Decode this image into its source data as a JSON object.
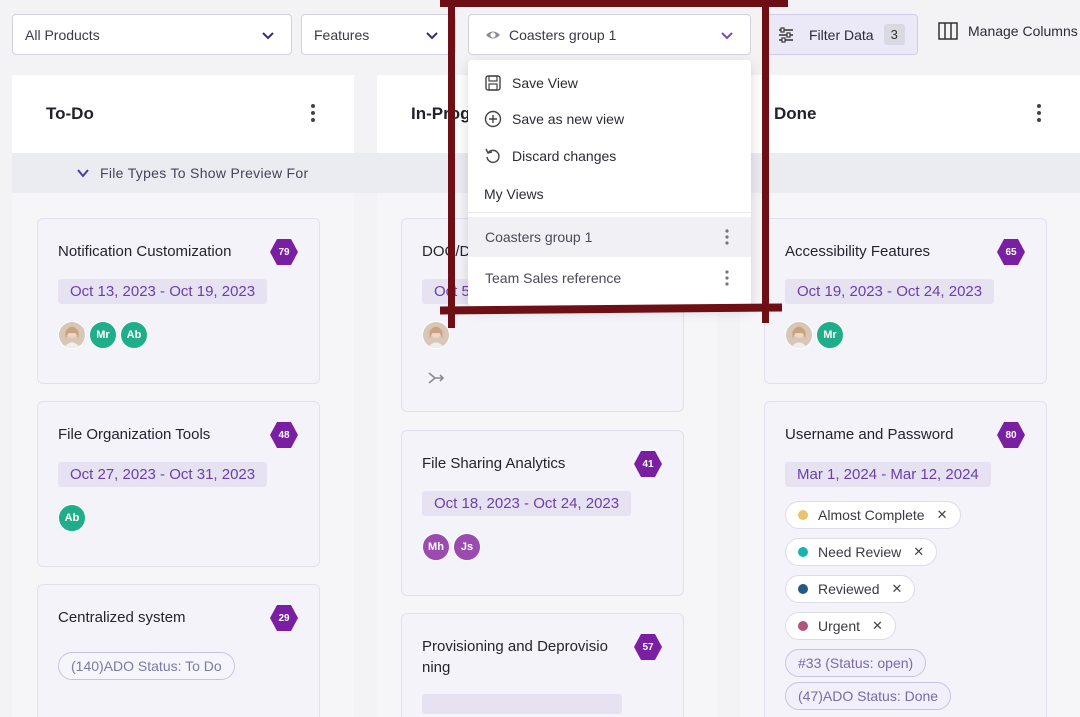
{
  "toolbar": {
    "products": "All Products",
    "features": "Features",
    "view": "Coasters group 1",
    "filter_label": "Filter Data",
    "filter_count": "3",
    "manage_label": "Manage Columns"
  },
  "columns": {
    "todo": "To-Do",
    "progress": "In-Progress",
    "done": "Done"
  },
  "group_label": "File Types To Show Preview For",
  "cards": {
    "c1": {
      "title": "Notification Customization",
      "badge": "79",
      "date": "Oct 13, 2023 - Oct 19, 2023",
      "av2": "Mr",
      "av3": "Ab"
    },
    "c2": {
      "title": "File Organization Tools",
      "badge": "48",
      "date": "Oct 27, 2023 - Oct 31, 2023",
      "av1": "Ab"
    },
    "c3": {
      "title": "Centralized system",
      "badge": "29",
      "tag": "(140)ADO Status: To Do"
    },
    "p1": {
      "title": "DOC/D",
      "date": "Oct 5"
    },
    "p2": {
      "title": "File Sharing Analytics",
      "badge": "41",
      "date": "Oct 18, 2023 - Oct 24, 2023",
      "av1": "Mh",
      "av2": "Js"
    },
    "p3": {
      "title_l1": "Provisioning and Deprovisio",
      "title_l2": "ning",
      "badge": "57"
    },
    "d1": {
      "title": "Accessibility Features",
      "badge": "65",
      "date": "Oct 19, 2023 - Oct 24, 2023",
      "av2": "Mr"
    },
    "d2": {
      "title": "Username and Password",
      "badge": "80",
      "date": "Mar 1, 2024 - Mar 12, 2024",
      "tags": [
        "Almost Complete",
        "Need Review",
        "Reviewed",
        "Urgent"
      ],
      "pill1": "#33 (Status: open)",
      "pill2": "(47)ADO Status: Done"
    }
  },
  "dropdown": {
    "save_view": "Save View",
    "save_new": "Save as new view",
    "discard": "Discard changes",
    "section": "My Views",
    "views": [
      "Coasters group 1",
      "Team Sales reference"
    ]
  },
  "colors": {
    "accent": "#7a1fa2",
    "highlight": "#6e0f16",
    "tag_almost": "#e9c46a",
    "tag_review": "#17b3b3",
    "tag_reviewed": "#1d5a86",
    "tag_urgent": "#b0567a"
  }
}
